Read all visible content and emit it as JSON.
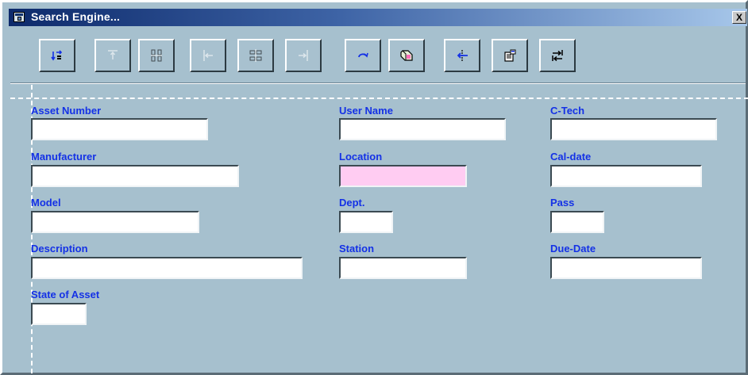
{
  "window": {
    "title": "Search Engine...",
    "close_glyph": "X"
  },
  "toolbar": {
    "buttons": [
      {
        "name": "sort-order",
        "icon": "sort-arrows-icon",
        "enabled": true
      },
      {
        "name": "align-top",
        "icon": "align-top-icon",
        "enabled": false
      },
      {
        "name": "center-vertical",
        "icon": "center-vertical-icon",
        "enabled": false
      },
      {
        "name": "align-left",
        "icon": "align-left-icon",
        "enabled": false
      },
      {
        "name": "center-horizontal",
        "icon": "center-horizontal-icon",
        "enabled": false
      },
      {
        "name": "align-right",
        "icon": "align-right-icon",
        "enabled": false
      },
      {
        "name": "refresh",
        "icon": "rotate-icon",
        "enabled": true
      },
      {
        "name": "clear",
        "icon": "eraser-icon",
        "enabled": true
      },
      {
        "name": "back",
        "icon": "arrow-left-icon",
        "enabled": true
      },
      {
        "name": "properties",
        "icon": "properties-icon",
        "enabled": true
      },
      {
        "name": "tab-order",
        "icon": "tab-order-icon",
        "enabled": true
      }
    ]
  },
  "fields": {
    "asset_number": {
      "label": "Asset Number",
      "value": ""
    },
    "manufacturer": {
      "label": "Manufacturer",
      "value": ""
    },
    "model": {
      "label": "Model",
      "value": ""
    },
    "description": {
      "label": "Description",
      "value": ""
    },
    "state_of_asset": {
      "label": "State of Asset",
      "value": ""
    },
    "user_name": {
      "label": "User Name",
      "value": ""
    },
    "location": {
      "label": "Location",
      "value": ""
    },
    "dept": {
      "label": "Dept.",
      "value": ""
    },
    "station": {
      "label": "Station",
      "value": ""
    },
    "c_tech": {
      "label": "C-Tech",
      "value": ""
    },
    "cal_date": {
      "label": "Cal-date",
      "value": ""
    },
    "pass": {
      "label": "Pass",
      "value": ""
    },
    "due_date": {
      "label": "Due-Date",
      "value": ""
    }
  },
  "colors": {
    "label": "#1431e6",
    "background": "#a6c0ce",
    "highlighted_field": "#ffccf2"
  }
}
